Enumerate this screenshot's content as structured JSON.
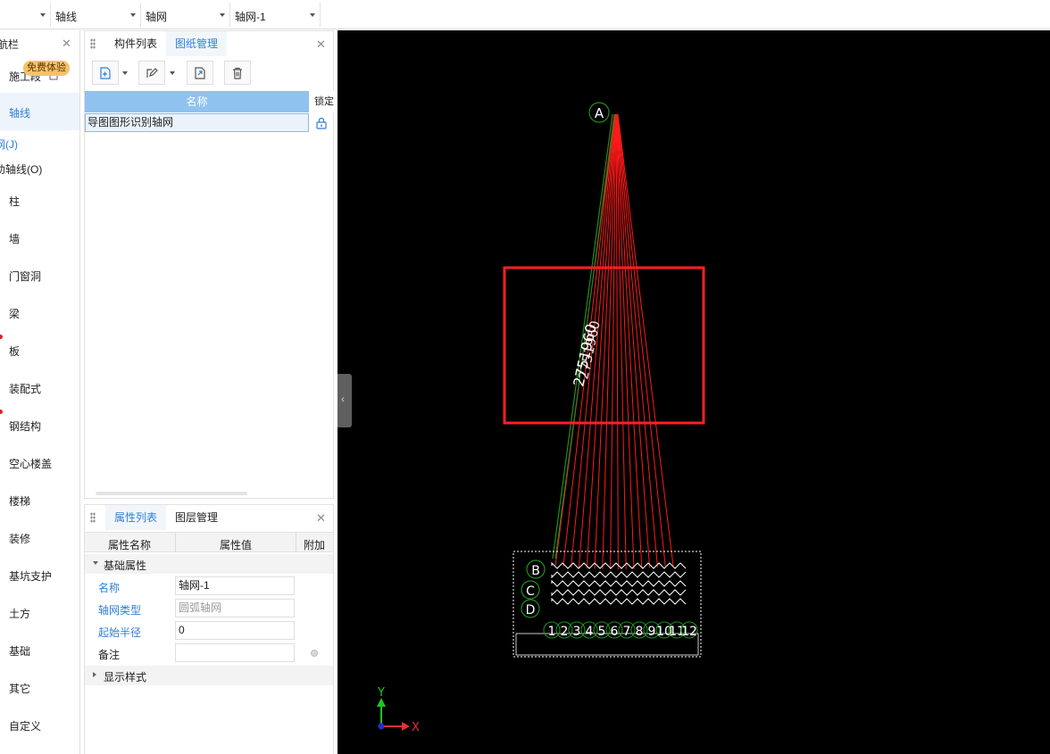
{
  "toolbar": {
    "dropdown_layer": "",
    "dropdown_type": "轴线",
    "dropdown_component": "轴网",
    "dropdown_instance": "轴网-1"
  },
  "nav": {
    "title": "航栏",
    "badge": "免费体验",
    "items": [
      {
        "label": "施工段"
      },
      {
        "label": "轴线"
      },
      {
        "label": "柱"
      },
      {
        "label": "墙"
      },
      {
        "label": "门窗洞"
      },
      {
        "label": "梁"
      },
      {
        "label": "板"
      },
      {
        "label": "装配式"
      },
      {
        "label": "钢结构"
      },
      {
        "label": "空心楼盖"
      },
      {
        "label": "楼梯"
      },
      {
        "label": "装修"
      },
      {
        "label": "基坑支护"
      },
      {
        "label": "土方"
      },
      {
        "label": "基础"
      },
      {
        "label": "其它"
      },
      {
        "label": "自定义"
      }
    ],
    "sub_items": [
      {
        "label": "网(J)"
      },
      {
        "label": "助轴线(O)"
      }
    ]
  },
  "drawing_panel": {
    "tabs": [
      {
        "label": "构件列表"
      },
      {
        "label": "图纸管理"
      }
    ],
    "table": {
      "columns": [
        "名称",
        "锁定"
      ],
      "rows": [
        {
          "name": "导图图形识别轴网",
          "locked": true
        }
      ]
    }
  },
  "property_panel": {
    "tabs": [
      {
        "label": "属性列表"
      },
      {
        "label": "图层管理"
      }
    ],
    "columns": [
      "属性名称",
      "属性值",
      "附加"
    ],
    "group_basic": "基础属性",
    "rows": [
      {
        "name": "名称",
        "value": ""
      },
      {
        "name": "轴网类型",
        "value": ""
      },
      {
        "name": "起始半径",
        "value": ""
      },
      {
        "name": "备注",
        "value": ""
      }
    ],
    "row_values": {
      "name": "轴网-1",
      "type": "圆弧轴网",
      "radius": "0",
      "note": ""
    },
    "group_display": "显示样式"
  },
  "canvas": {
    "axis_label_top": "A",
    "dimension_text": "2751960",
    "row_labels": [
      "B",
      "C",
      "D"
    ],
    "column_labels": [
      "1",
      "2",
      "3",
      "4",
      "5",
      "6",
      "7",
      "8",
      "9",
      "10",
      "11",
      "12"
    ],
    "axis_x_label": "X",
    "axis_y_label": "Y",
    "colors": {
      "background": "#000000",
      "radial_lines": "#ff1a1a",
      "axis_circles": "#1e8f1e",
      "highlight_box": "#ff2020"
    }
  }
}
